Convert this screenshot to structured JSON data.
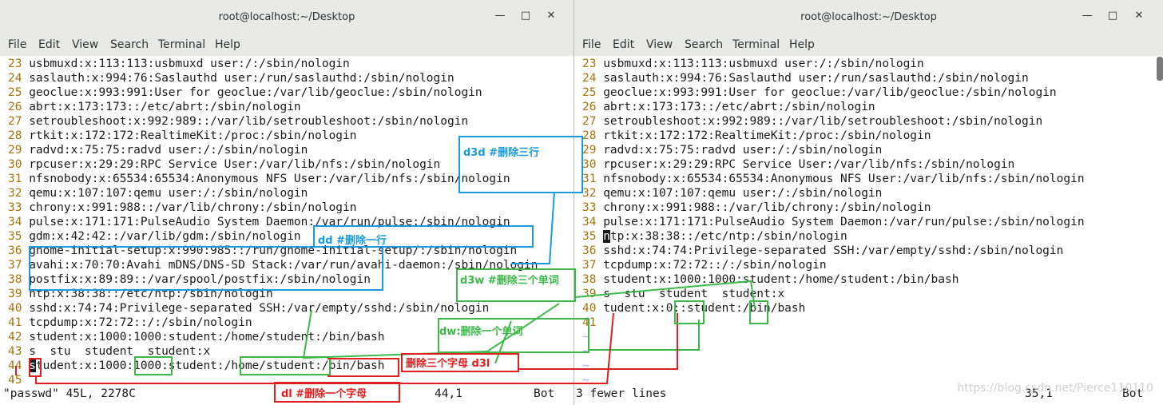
{
  "left": {
    "title": "root@localhost:~/Desktop",
    "menu": [
      "File",
      "Edit",
      "View",
      "Search",
      "Terminal",
      "Help"
    ],
    "lines": [
      {
        "n": "23",
        "t": "usbmuxd:x:113:113:usbmuxd user:/:/sbin/nologin"
      },
      {
        "n": "24",
        "t": "saslauth:x:994:76:Saslauthd user:/run/saslauthd:/sbin/nologin"
      },
      {
        "n": "25",
        "t": "geoclue:x:993:991:User for geoclue:/var/lib/geoclue:/sbin/nologin"
      },
      {
        "n": "26",
        "t": "abrt:x:173:173::/etc/abrt:/sbin/nologin"
      },
      {
        "n": "27",
        "t": "setroubleshoot:x:992:989::/var/lib/setroubleshoot:/sbin/nologin"
      },
      {
        "n": "28",
        "t": "rtkit:x:172:172:RealtimeKit:/proc:/sbin/nologin"
      },
      {
        "n": "29",
        "t": "radvd:x:75:75:radvd user:/:/sbin/nologin"
      },
      {
        "n": "30",
        "t": "rpcuser:x:29:29:RPC Service User:/var/lib/nfs:/sbin/nologin"
      },
      {
        "n": "31",
        "t": "nfsnobody:x:65534:65534:Anonymous NFS User:/var/lib/nfs:/sbin/nologin"
      },
      {
        "n": "32",
        "t": "qemu:x:107:107:qemu user:/:/sbin/nologin"
      },
      {
        "n": "33",
        "t": "chrony:x:991:988::/var/lib/chrony:/sbin/nologin"
      },
      {
        "n": "34",
        "t": "pulse:x:171:171:PulseAudio System Daemon:/var/run/pulse:/sbin/nologin"
      },
      {
        "n": "35",
        "t": "gdm:x:42:42::/var/lib/gdm:/sbin/nologin"
      },
      {
        "n": "36",
        "t": "gnome-initial-setup:x:990:985::/run/gnome-initial-setup/:/sbin/nologin"
      },
      {
        "n": "37",
        "t": "avahi:x:70:70:Avahi mDNS/DNS-SD Stack:/var/run/avahi-daemon:/sbin/nologin"
      },
      {
        "n": "38",
        "t": "postfix:x:89:89::/var/spool/postfix:/sbin/nologin"
      },
      {
        "n": "39",
        "t": "ntp:x:38:38::/etc/ntp:/sbin/nologin"
      },
      {
        "n": "40",
        "t": "sshd:x:74:74:Privilege-separated SSH:/var/empty/sshd:/sbin/nologin"
      },
      {
        "n": "41",
        "t": "tcpdump:x:72:72::/:/sbin/nologin"
      },
      {
        "n": "42",
        "t": "student:x:1000:1000:student:/home/student:/bin/bash"
      },
      {
        "n": "43",
        "t": "s  stu  student  student:x"
      },
      {
        "n": "44",
        "t": "student:x:1000:1000:student:/home/student:/bin/bash"
      },
      {
        "n": "45",
        "t": ""
      }
    ],
    "status_left": "\"passwd\" 45L, 2278C",
    "status_pos": "44,1",
    "status_right": "Bot"
  },
  "right": {
    "title": "root@localhost:~/Desktop",
    "menu": [
      "File",
      "Edit",
      "View",
      "Search",
      "Terminal",
      "Help"
    ],
    "lines": [
      {
        "n": "23",
        "t": "usbmuxd:x:113:113:usbmuxd user:/:/sbin/nologin"
      },
      {
        "n": "24",
        "t": "saslauth:x:994:76:Saslauthd user:/run/saslauthd:/sbin/nologin"
      },
      {
        "n": "25",
        "t": "geoclue:x:993:991:User for geoclue:/var/lib/geoclue:/sbin/nologin"
      },
      {
        "n": "26",
        "t": "abrt:x:173:173::/etc/abrt:/sbin/nologin"
      },
      {
        "n": "27",
        "t": "setroubleshoot:x:992:989::/var/lib/setroubleshoot:/sbin/nologin"
      },
      {
        "n": "28",
        "t": "rtkit:x:172:172:RealtimeKit:/proc:/sbin/nologin"
      },
      {
        "n": "29",
        "t": "radvd:x:75:75:radvd user:/:/sbin/nologin"
      },
      {
        "n": "30",
        "t": "rpcuser:x:29:29:RPC Service User:/var/lib/nfs:/sbin/nologin"
      },
      {
        "n": "31",
        "t": "nfsnobody:x:65534:65534:Anonymous NFS User:/var/lib/nfs:/sbin/nologin"
      },
      {
        "n": "32",
        "t": "qemu:x:107:107:qemu user:/:/sbin/nologin"
      },
      {
        "n": "33",
        "t": "chrony:x:991:988::/var/lib/chrony:/sbin/nologin"
      },
      {
        "n": "34",
        "t": "pulse:x:171:171:PulseAudio System Daemon:/var/run/pulse:/sbin/nologin"
      },
      {
        "n": "35",
        "t": "ntp:x:38:38::/etc/ntp:/sbin/nologin"
      },
      {
        "n": "36",
        "t": "sshd:x:74:74:Privilege-separated SSH:/var/empty/sshd:/sbin/nologin"
      },
      {
        "n": "37",
        "t": "tcpdump:x:72:72::/:/sbin/nologin"
      },
      {
        "n": "38",
        "t": "student:x:1000:1000:student:/home/student:/bin/bash"
      },
      {
        "n": "39",
        "t": "s  stu  student  student:x"
      },
      {
        "n": "40",
        "t": "tudent:x:0::student:/bin/bash"
      },
      {
        "n": "41",
        "t": ""
      }
    ],
    "tildes": [
      "~",
      "~",
      "~",
      "~"
    ],
    "status_left": "3 fewer lines",
    "status_pos": "35,1",
    "status_right": "Bot"
  },
  "annotations": {
    "d3d": "d3d  #删除三行",
    "dd": "dd  #删除一行",
    "d3w": "d3w  #删除三个单词",
    "dw": "dw:删除一个单词",
    "d3l": "删除三个字母  d3l",
    "dl": "dl   #删除一个字母"
  },
  "watermark": "https://blog.csdn.net/Pierce110110",
  "colors": {
    "blue": "#1a9be0",
    "green": "#3cb94a",
    "red": "#e02020",
    "line_number": "#a6740c",
    "tilde": "#a5a5ff"
  }
}
